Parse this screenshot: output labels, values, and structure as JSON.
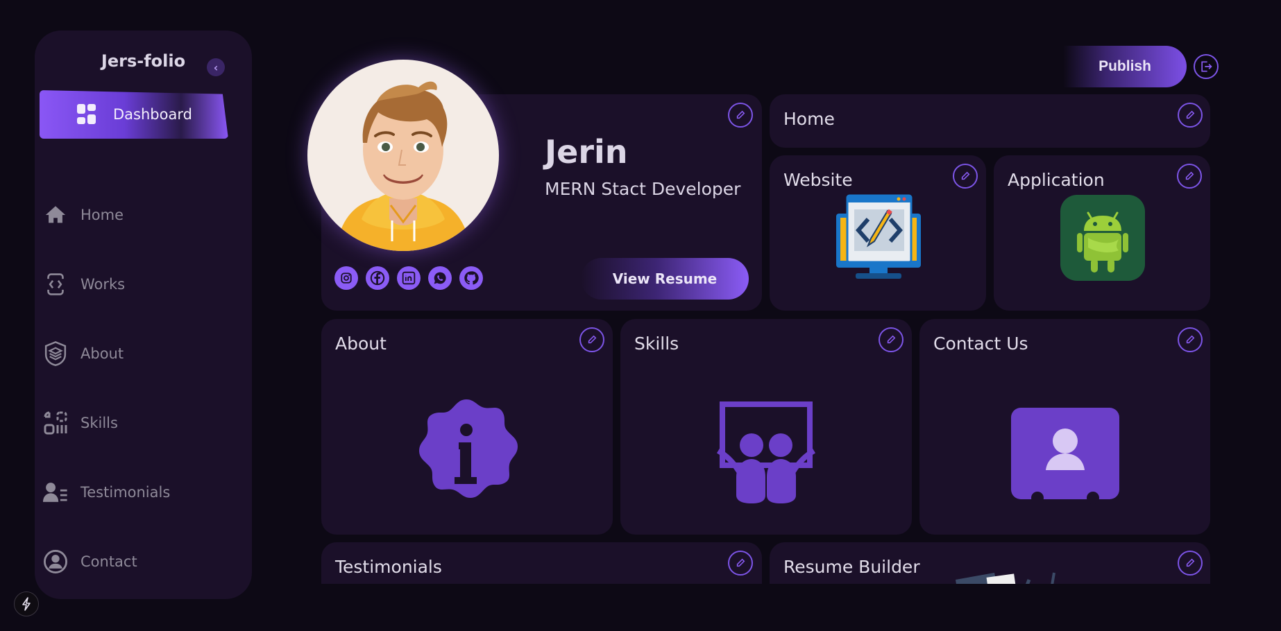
{
  "sidebar": {
    "brand": "Jers-folio",
    "items": [
      {
        "label": "Dashboard",
        "icon": "dashboard-grid-icon",
        "active": true
      },
      {
        "label": "Home",
        "icon": "house-icon"
      },
      {
        "label": "Works",
        "icon": "code-device-icon"
      },
      {
        "label": "About",
        "icon": "layers-shield-icon"
      },
      {
        "label": "Skills",
        "icon": "shapes-icon"
      },
      {
        "label": "Testimonials",
        "icon": "user-list-icon"
      },
      {
        "label": "Contact",
        "icon": "user-circle-icon"
      }
    ]
  },
  "header": {
    "publish_label": "Publish",
    "logout_icon": "logout-icon"
  },
  "profile": {
    "name": "Jerin",
    "role": "MERN Stact Developer",
    "resume_label": "View Resume",
    "socials": [
      "instagram-icon",
      "facebook-icon",
      "linkedin-icon",
      "whatsapp-icon",
      "github-icon"
    ]
  },
  "cards": {
    "home": "Home",
    "website": "Website",
    "application": "Application",
    "about": "About",
    "skills": "Skills",
    "contact": "Contact Us",
    "testimonials": "Testimonials",
    "resume_builder": "Resume Builder"
  },
  "colors": {
    "background": "#0d0915",
    "panel": "#1b1029",
    "accent": "#8b5cf6",
    "icon_purple": "#6b3fc8",
    "nav_text": "#8f8a99"
  }
}
